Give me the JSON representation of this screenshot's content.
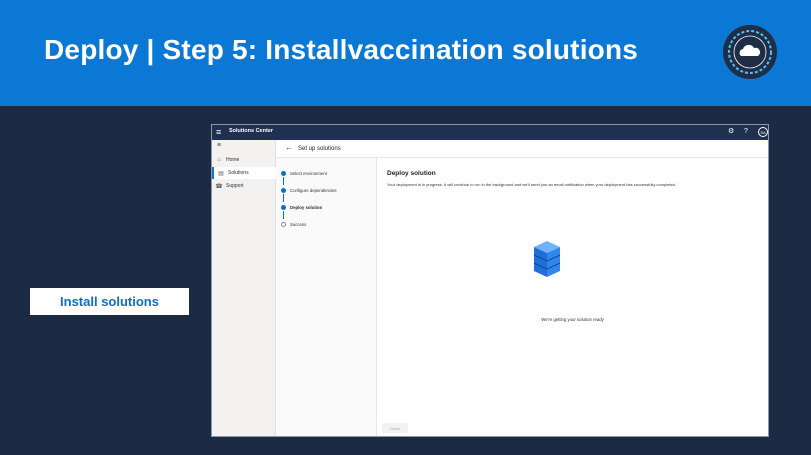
{
  "slide": {
    "title": "Deploy | Step 5: Installvaccination solutions",
    "label": "Install solutions"
  },
  "app": {
    "name": "Solutions Center",
    "topbar_icons": [
      "gear-icon",
      "help-icon",
      "avatar"
    ],
    "avatar_initials": "SA",
    "nav": [
      {
        "label": "Home",
        "icon": "home-icon"
      },
      {
        "label": "Solutions",
        "icon": "solutions-icon",
        "active": true
      },
      {
        "label": "Support",
        "icon": "support-icon"
      }
    ],
    "page_title": "Set up solutions",
    "steps": [
      {
        "label": "Select environment",
        "state": "done"
      },
      {
        "label": "Configure dependencies",
        "state": "done"
      },
      {
        "label": "Deploy solution",
        "state": "current"
      },
      {
        "label": "Success",
        "state": "pending"
      }
    ],
    "content": {
      "title": "Deploy solution",
      "description": "Your deployment is in progress. It will continue to run in the background and we'll send you an email notification when your deployment has successfully completed.",
      "status": "We're getting your solution ready",
      "button_label": "Done"
    }
  },
  "colors": {
    "banner": "#0a78d4",
    "slide_background": "#1c2a43",
    "app_topbar": "#1f3050",
    "accent": "#0a6fc9"
  }
}
